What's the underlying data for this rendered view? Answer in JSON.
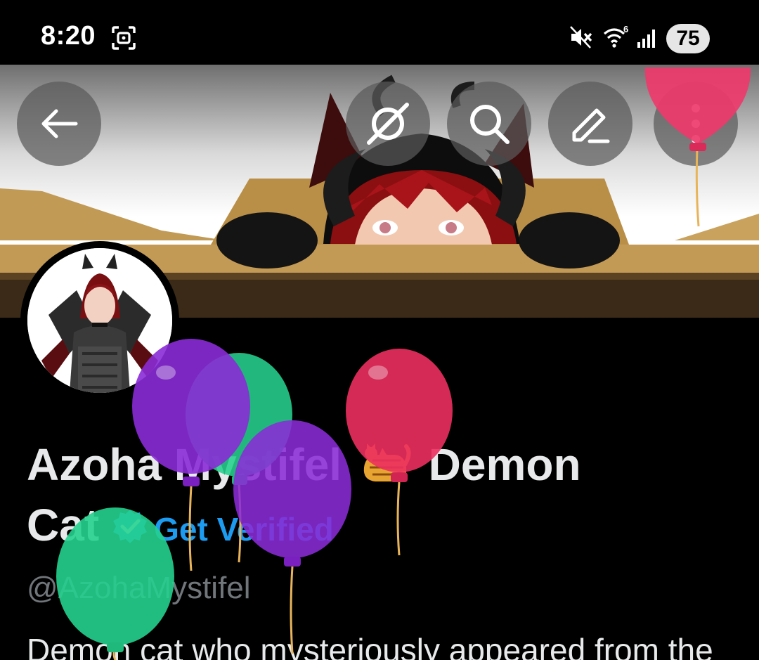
{
  "status_bar": {
    "time": "8:20",
    "battery": "75",
    "icons": [
      "screenshot-icon",
      "mute-icon",
      "wifi-6-icon",
      "signal-icon"
    ]
  },
  "header": {
    "buttons": [
      "back-arrow-icon",
      "grok-icon",
      "search-icon",
      "edit-icon",
      "more-icon"
    ]
  },
  "profile": {
    "name_part1": "Azoha Mystifel",
    "name_part2": "Demon",
    "name_part3": "Cat",
    "name_emoji": "cat-emoji",
    "verified_badge": "verified-badge-icon",
    "get_verified": "Get Verified",
    "handle": "@AzohaMystifel",
    "bio": "Demon cat who mysteriously appeared from the"
  },
  "colors": {
    "background": "#000000",
    "text": "#e7e9ea",
    "muted": "#71767b",
    "accent": "#1d9bf0"
  }
}
